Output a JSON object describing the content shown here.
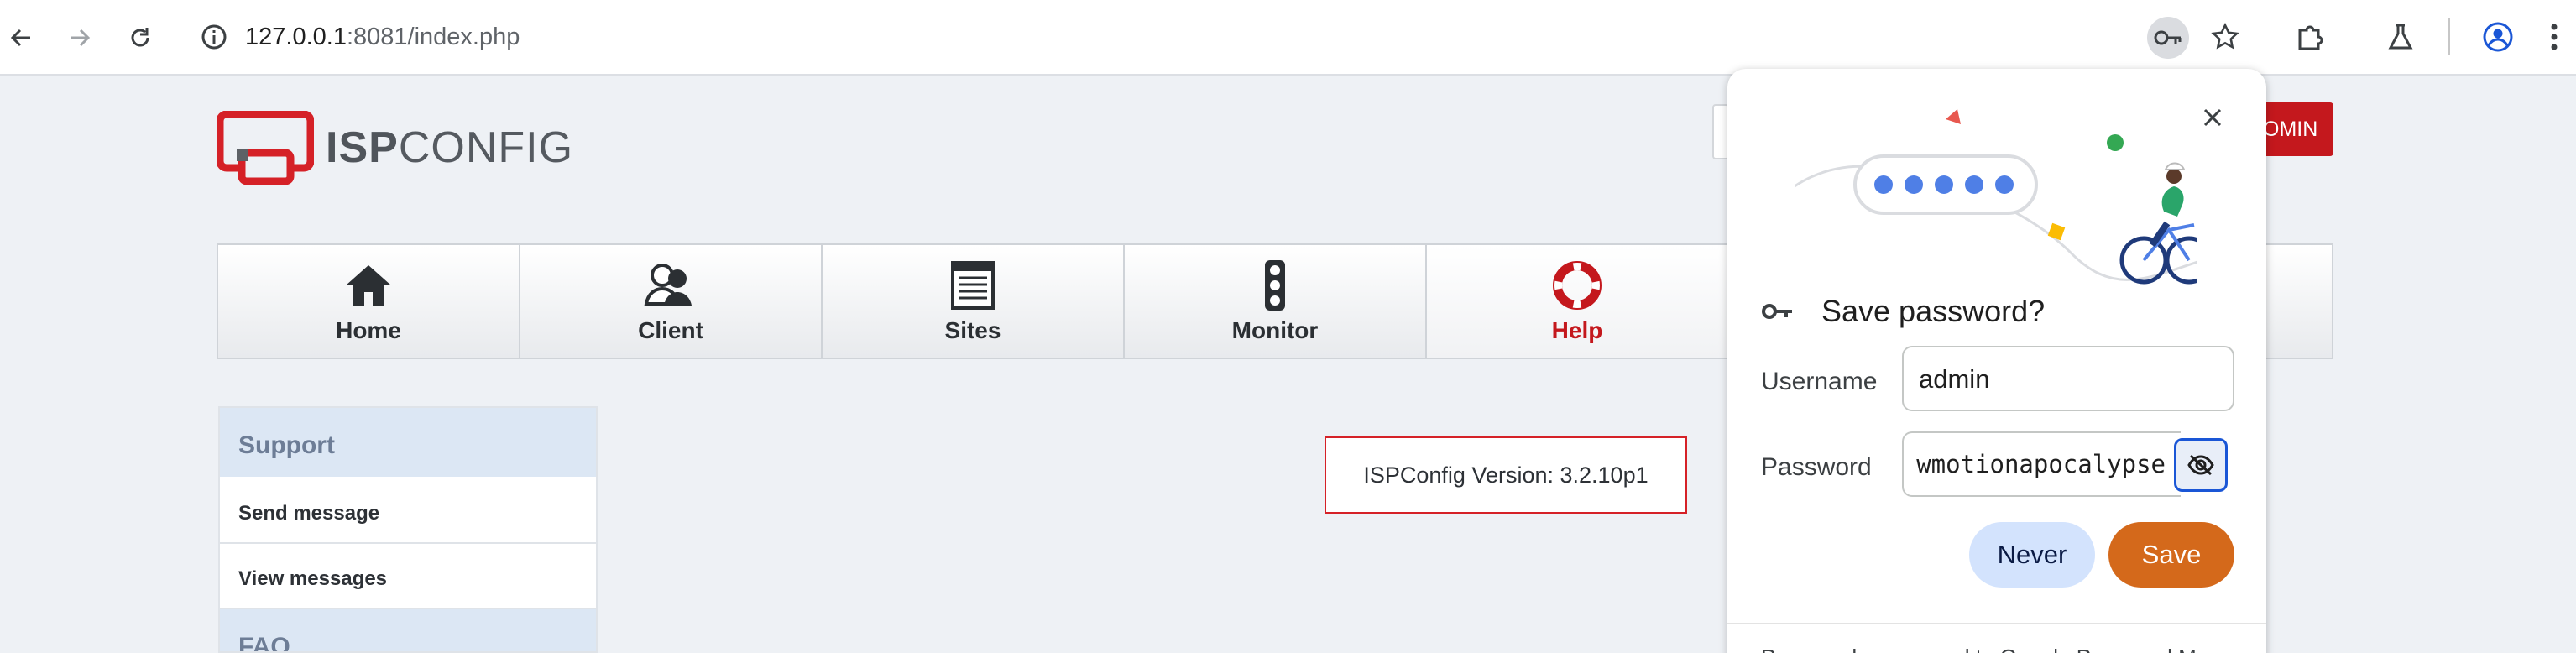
{
  "browser": {
    "url_host": "127.0.0.1",
    "url_rest": ":8081/index.php",
    "icons": [
      "back-icon",
      "forward-icon",
      "reload-icon",
      "site-info-icon",
      "password-key-icon",
      "bookmark-star-icon",
      "extensions-icon",
      "labs-flask-icon",
      "profile-icon",
      "menu-icon"
    ]
  },
  "header": {
    "logo_text_bold": "ISP",
    "logo_text_light": "CONFIG",
    "admin_label": "OMIN"
  },
  "nav": {
    "items": [
      {
        "label": "Home",
        "icon": "home-icon"
      },
      {
        "label": "Client",
        "icon": "client-icon"
      },
      {
        "label": "Sites",
        "icon": "sites-icon"
      },
      {
        "label": "Monitor",
        "icon": "monitor-icon"
      },
      {
        "label": "Help",
        "icon": "help-lifebuoy-icon",
        "active": true
      }
    ]
  },
  "sidebar": {
    "section1": "Support",
    "items": [
      "Send message",
      "View messages"
    ],
    "section2": "FAQ"
  },
  "main": {
    "version_text": "ISPConfig Version: 3.2.10p1"
  },
  "password_bubble": {
    "title": "Save password?",
    "username_label": "Username",
    "username_value": "admin",
    "password_label": "Password",
    "password_value": "wmotionapocalypse",
    "never_label": "Never",
    "save_label": "Save",
    "footer_text": "Passwords are saved to Google Password Manager"
  },
  "colors": {
    "accent_red": "#c4181d",
    "save_orange": "#d4691b",
    "never_blue": "#d3e3fd"
  }
}
